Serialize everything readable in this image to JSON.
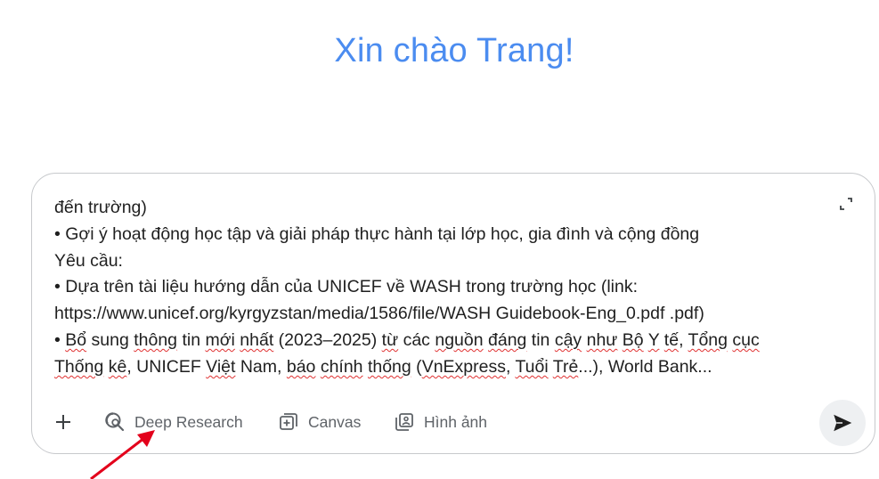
{
  "greeting": "Xin chào Trang!",
  "prompt": {
    "lines": [
      [
        {
          "t": "đến trường)"
        }
      ],
      [
        {
          "t": "• Gợi ý hoạt động học tập và giải pháp thực hành tại lớp học, gia đình và cộng đồng"
        }
      ],
      [
        {
          "t": "Yêu cầu:"
        }
      ],
      [
        {
          "t": "• Dựa trên tài liệu hướng dẫn của UNICEF về WASH trong trường học (link:"
        }
      ],
      [
        {
          "t": "https://www.unicef.org/kyrgyzstan/media/1586/file/WASH Guidebook-Eng_0.pdf .pdf)"
        }
      ],
      [
        {
          "t": "• "
        },
        {
          "t": "Bổ",
          "s": true
        },
        {
          "t": " sung "
        },
        {
          "t": "thông",
          "s": true
        },
        {
          "t": " tin "
        },
        {
          "t": "mới",
          "s": true
        },
        {
          "t": " "
        },
        {
          "t": "nhất",
          "s": true
        },
        {
          "t": " (2023–2025) "
        },
        {
          "t": "từ",
          "s": true
        },
        {
          "t": " các "
        },
        {
          "t": "nguồn",
          "s": true
        },
        {
          "t": " "
        },
        {
          "t": "đáng",
          "s": true
        },
        {
          "t": " tin "
        },
        {
          "t": "cậy",
          "s": true
        },
        {
          "t": " "
        },
        {
          "t": "như",
          "s": true
        },
        {
          "t": " "
        },
        {
          "t": "Bộ",
          "s": true
        },
        {
          "t": " "
        },
        {
          "t": "Y",
          "s": true
        },
        {
          "t": " "
        },
        {
          "t": "tế",
          "s": true
        },
        {
          "t": ", "
        },
        {
          "t": "Tổng",
          "s": true
        },
        {
          "t": " "
        },
        {
          "t": "cục",
          "s": true
        }
      ],
      [
        {
          "t": "Thống",
          "s": true
        },
        {
          "t": " "
        },
        {
          "t": "kê",
          "s": true
        },
        {
          "t": ", UNICEF "
        },
        {
          "t": "Việt",
          "s": true
        },
        {
          "t": " Nam, "
        },
        {
          "t": "báo",
          "s": true
        },
        {
          "t": " "
        },
        {
          "t": "chính",
          "s": true
        },
        {
          "t": " "
        },
        {
          "t": "thống",
          "s": true
        },
        {
          "t": " ("
        },
        {
          "t": "VnExpress",
          "s": true
        },
        {
          "t": ", "
        },
        {
          "t": "Tuổi",
          "s": true
        },
        {
          "t": " "
        },
        {
          "t": "Trẻ",
          "s": true
        },
        {
          "t": "...), World Bank..."
        }
      ]
    ]
  },
  "toolbar": {
    "deep_research": "Deep Research",
    "canvas": "Canvas",
    "image": "Hình ảnh"
  },
  "icons": {
    "plus": "plus-icon",
    "deep_research": "deep-research-icon",
    "canvas": "canvas-icon",
    "image": "image-icon",
    "send": "send-icon",
    "expand": "expand-icon"
  },
  "colors": {
    "greeting": "#4b8cf0",
    "annotation_arrow": "#e3001b",
    "spellcheck": "#e03131"
  }
}
